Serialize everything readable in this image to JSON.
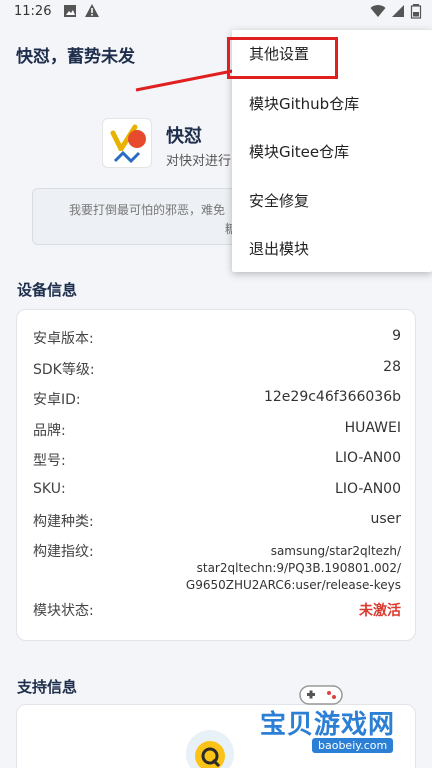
{
  "status_bar": {
    "time": "11:26"
  },
  "app_bar": {
    "title": "快怼，蓄势未发"
  },
  "module": {
    "name": "快怼",
    "description": "对快对进行",
    "quote_line1": "我要打倒最可怕的邪恶，难免",
    "quote_line2": "糖衣。"
  },
  "device_info": {
    "title": "设备信息",
    "rows": [
      {
        "label": "安卓版本:",
        "value": "9"
      },
      {
        "label": "SDK等级:",
        "value": "28"
      },
      {
        "label": "安卓ID:",
        "value": "12e29c46f366036b"
      },
      {
        "label": "品牌:",
        "value": "HUAWEI"
      },
      {
        "label": "型号:",
        "value": "LIO-AN00"
      },
      {
        "label": "SKU:",
        "value": "LIO-AN00"
      },
      {
        "label": "构建种类:",
        "value": "user"
      },
      {
        "label": "构建指纹:",
        "value_lines": [
          "samsung/star2qltezh/",
          "star2qltechn:9/PQ3B.190801.002/",
          "G9650ZHU2ARC6:user/release-keys"
        ]
      },
      {
        "label": "模块状态:",
        "value": "未激活"
      }
    ]
  },
  "support_info": {
    "title": "支持信息"
  },
  "overflow_menu": {
    "items": [
      "其他设置",
      "模块Github仓库",
      "模块Gitee仓库",
      "安全修复",
      "退出模块"
    ]
  },
  "watermark": {
    "text": "宝贝游戏网",
    "url": "baobeiy.com"
  },
  "colors": {
    "accent": "#1e2e4c",
    "status_inactive": "#d93b2e",
    "annotation": "#e02020"
  }
}
